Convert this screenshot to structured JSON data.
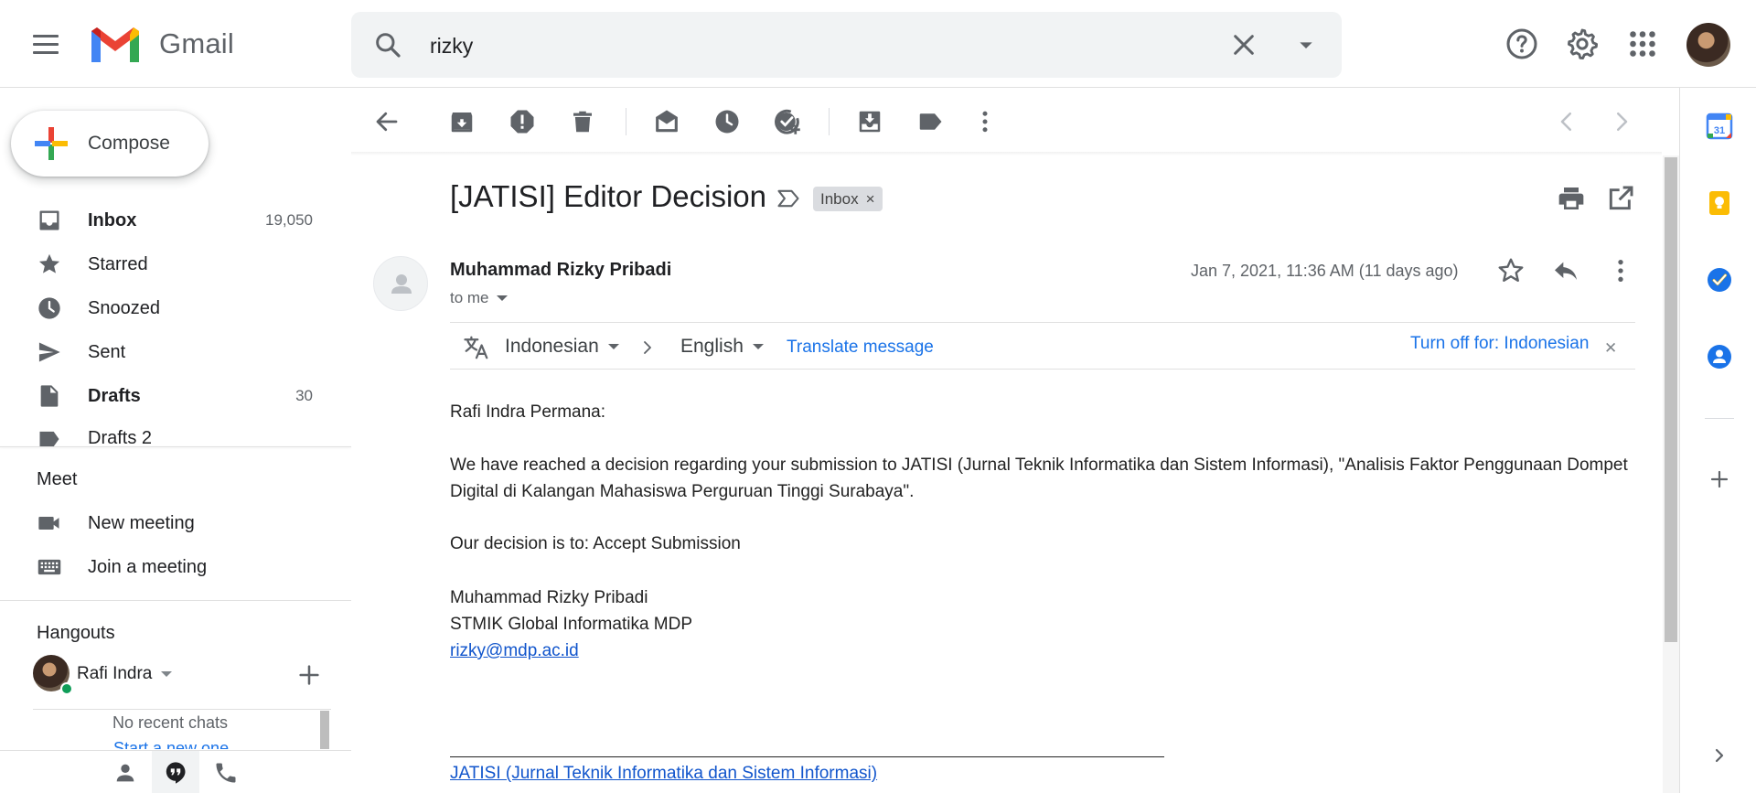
{
  "header": {
    "brand": "Gmail",
    "search_value": "rizky"
  },
  "compose": {
    "label": "Compose"
  },
  "nav": {
    "items": [
      {
        "label": "Inbox",
        "count": "19,050",
        "icon": "inbox-icon",
        "bold": true
      },
      {
        "label": "Starred",
        "count": "",
        "icon": "star-icon",
        "bold": false
      },
      {
        "label": "Snoozed",
        "count": "",
        "icon": "clock-icon",
        "bold": false
      },
      {
        "label": "Sent",
        "count": "",
        "icon": "send-icon",
        "bold": false
      },
      {
        "label": "Drafts",
        "count": "30",
        "icon": "draft-icon",
        "bold": true
      },
      {
        "label": "Drafts 2",
        "count": "",
        "icon": "label-icon",
        "bold": false
      }
    ]
  },
  "meet": {
    "title": "Meet",
    "new_meeting": "New meeting",
    "join_meeting": "Join a meeting"
  },
  "hangouts": {
    "title": "Hangouts",
    "user_name": "Rafi Indra",
    "no_chats": "No recent chats",
    "start_new": "Start a new one"
  },
  "message": {
    "subject": "[JATISI] Editor Decision",
    "label_chip": "Inbox",
    "sender": "Muhammad Rizky Pribadi",
    "recipient": "to me",
    "date": "Jan 7, 2021, 11:36 AM (11 days ago)",
    "translate": {
      "from": "Indonesian",
      "to": "English",
      "action": "Translate message",
      "turn_off": "Turn off for: Indonesian"
    },
    "greeting": "Rafi Indra Permana:",
    "para1": "We have reached a decision regarding your submission to JATISI (Jurnal Teknik Informatika dan Sistem Informasi), \"Analisis Faktor Penggunaan Dompet Digital di Kalangan Mahasiswa Perguruan Tinggi Surabaya\".",
    "decision": "Our decision is to: Accept Submission",
    "sig_name": "Muhammad Rizky Pribadi",
    "sig_org": "STMIK Global Informatika MDP",
    "sig_email": "rizky@mdp.ac.id",
    "footer_link": "JATISI (Jurnal Teknik Informatika dan Sistem Informasi)"
  },
  "colors": {
    "accent_blue": "#1a73e8",
    "link_blue": "#1155cc",
    "icon_gray": "#5f6368",
    "online_green": "#0f9d58"
  }
}
